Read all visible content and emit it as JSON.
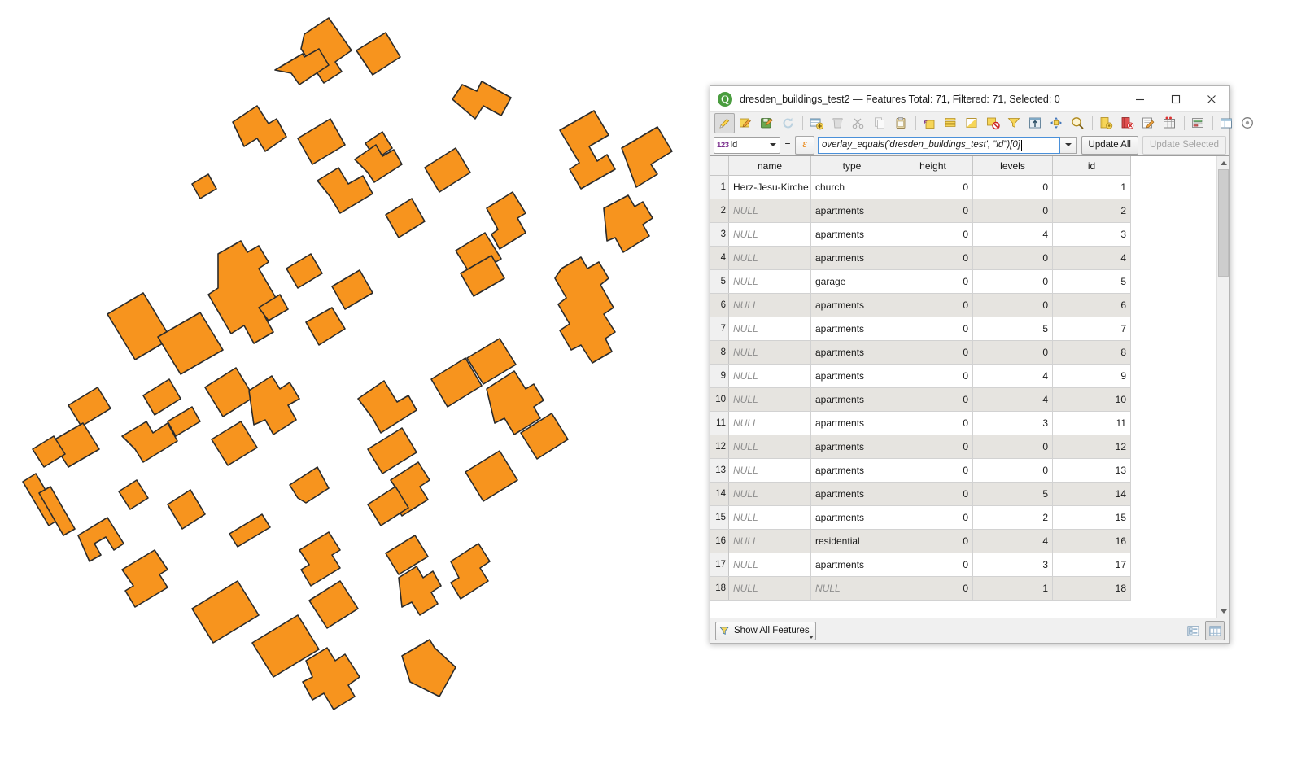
{
  "window": {
    "title": "dresden_buildings_test2 — Features Total: 71, Filtered: 71, Selected: 0",
    "app_icon": "qgis-logo-icon",
    "minimize_label": "─",
    "maximize_label": "☐",
    "close_label": "✕"
  },
  "toolbar": {
    "buttons": [
      {
        "name": "toggle-editing-icon",
        "tip": "Toggle editing mode"
      },
      {
        "name": "save-edits-icon",
        "tip": "Save edits"
      },
      {
        "name": "save-layer-edits-icon",
        "tip": "Save layer edits"
      },
      {
        "name": "reload-table-icon",
        "tip": "Reload the table"
      },
      {
        "name": "add-feature-icon",
        "tip": "Add feature"
      },
      {
        "name": "delete-selected-icon",
        "tip": "Delete selected features"
      },
      {
        "name": "cut-features-icon",
        "tip": "Cut features"
      },
      {
        "name": "copy-features-icon",
        "tip": "Copy features"
      },
      {
        "name": "paste-features-icon",
        "tip": "Paste features"
      },
      {
        "name": "select-by-expression-icon",
        "tip": "Select features using an expression"
      },
      {
        "name": "select-all-icon",
        "tip": "Select all features"
      },
      {
        "name": "invert-selection-icon",
        "tip": "Invert selection"
      },
      {
        "name": "deselect-all-icon",
        "tip": "Deselect all features"
      },
      {
        "name": "filter-selection-icon",
        "tip": "Filter / select features using form"
      },
      {
        "name": "move-selection-to-top-icon",
        "tip": "Move selection to top"
      },
      {
        "name": "pan-map-to-selection-icon",
        "tip": "Pan map to selected rows"
      },
      {
        "name": "zoom-map-to-selection-icon",
        "tip": "Zoom map to selected rows"
      },
      {
        "name": "new-field-icon",
        "tip": "New field"
      },
      {
        "name": "delete-field-icon",
        "tip": "Delete field"
      },
      {
        "name": "open-field-calculator-icon",
        "tip": "Open field calculator"
      },
      {
        "name": "conditional-formatting-icon",
        "tip": "Conditional formatting"
      },
      {
        "name": "organize-columns-icon",
        "tip": "Organize columns"
      },
      {
        "name": "dock-undock-icon",
        "tip": "Dock / undock attribute table"
      },
      {
        "name": "actions-icon",
        "tip": "Actions"
      }
    ]
  },
  "expression_bar": {
    "field_prefix": "123",
    "field_value": "id",
    "equals": "=",
    "epsilon_label": "ε",
    "expression": "overlay_equals('dresden_buildings_test', \"id\")[0]",
    "update_all_label": "Update All",
    "update_selected_label": "Update Selected",
    "update_selected_disabled": true
  },
  "table": {
    "columns": [
      "name",
      "type",
      "height",
      "levels",
      "id"
    ],
    "rows": [
      {
        "n": "1",
        "name": "Herz-Jesu-Kirche",
        "type": "church",
        "height": "0",
        "levels": "0",
        "id": "1"
      },
      {
        "n": "2",
        "name": "NULL",
        "type": "apartments",
        "height": "0",
        "levels": "0",
        "id": "2"
      },
      {
        "n": "3",
        "name": "NULL",
        "type": "apartments",
        "height": "0",
        "levels": "4",
        "id": "3"
      },
      {
        "n": "4",
        "name": "NULL",
        "type": "apartments",
        "height": "0",
        "levels": "0",
        "id": "4"
      },
      {
        "n": "5",
        "name": "NULL",
        "type": "garage",
        "height": "0",
        "levels": "0",
        "id": "5"
      },
      {
        "n": "6",
        "name": "NULL",
        "type": "apartments",
        "height": "0",
        "levels": "0",
        "id": "6"
      },
      {
        "n": "7",
        "name": "NULL",
        "type": "apartments",
        "height": "0",
        "levels": "5",
        "id": "7"
      },
      {
        "n": "8",
        "name": "NULL",
        "type": "apartments",
        "height": "0",
        "levels": "0",
        "id": "8"
      },
      {
        "n": "9",
        "name": "NULL",
        "type": "apartments",
        "height": "0",
        "levels": "4",
        "id": "9"
      },
      {
        "n": "10",
        "name": "NULL",
        "type": "apartments",
        "height": "0",
        "levels": "4",
        "id": "10"
      },
      {
        "n": "11",
        "name": "NULL",
        "type": "apartments",
        "height": "0",
        "levels": "3",
        "id": "11"
      },
      {
        "n": "12",
        "name": "NULL",
        "type": "apartments",
        "height": "0",
        "levels": "0",
        "id": "12"
      },
      {
        "n": "13",
        "name": "NULL",
        "type": "apartments",
        "height": "0",
        "levels": "0",
        "id": "13"
      },
      {
        "n": "14",
        "name": "NULL",
        "type": "apartments",
        "height": "0",
        "levels": "5",
        "id": "14"
      },
      {
        "n": "15",
        "name": "NULL",
        "type": "apartments",
        "height": "0",
        "levels": "2",
        "id": "15"
      },
      {
        "n": "16",
        "name": "NULL",
        "type": "residential",
        "height": "0",
        "levels": "4",
        "id": "16"
      },
      {
        "n": "17",
        "name": "NULL",
        "type": "apartments",
        "height": "0",
        "levels": "3",
        "id": "17"
      },
      {
        "n": "18",
        "name": "NULL",
        "type": "NULL",
        "height": "0",
        "levels": "1",
        "id": "18"
      }
    ]
  },
  "statusbar": {
    "show_all_features_label": "Show All Features",
    "filter_icon": "funnel-icon",
    "form_view_icon": "form-view-icon",
    "table_view_icon": "table-view-icon"
  },
  "map": {
    "fill_color": "#F7941E",
    "stroke_color": "#2b2b2b",
    "background": "#FFFFFF"
  }
}
